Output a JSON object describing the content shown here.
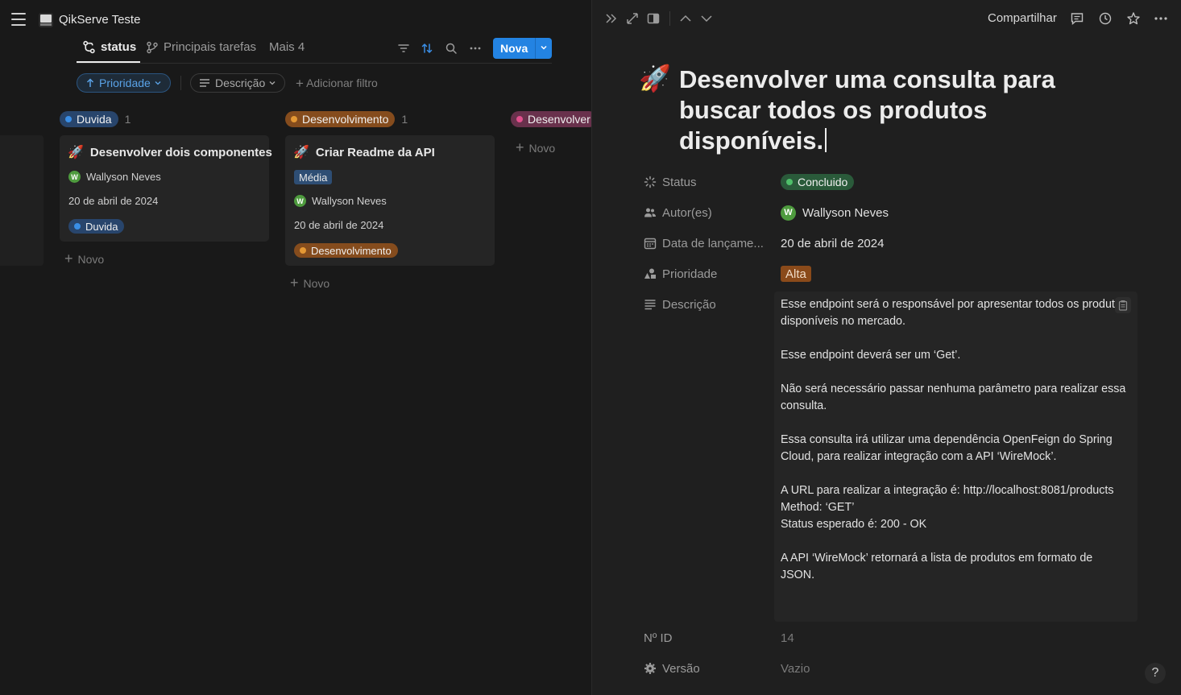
{
  "workspace": {
    "title": "QikServe Teste"
  },
  "views": {
    "tabs": [
      {
        "label": "status"
      },
      {
        "label": "Principais tarefas"
      },
      {
        "label": "Mais 4"
      }
    ],
    "new_label": "Nova"
  },
  "filters": {
    "sort_label": "Prioridade",
    "desc_label": "Descrição",
    "add_filter_label": "Adicionar filtro"
  },
  "board": {
    "new_label": "Novo",
    "columns": [
      {
        "name": "Duvida",
        "count": "1",
        "color": "#3a8ee6",
        "cards": [
          {
            "title": "Desenvolver dois componentes",
            "author_initial": "W",
            "author": "Wallyson Neves",
            "date": "20 de abril de 2024",
            "status": "Duvida"
          }
        ]
      },
      {
        "name": "Desenvolvimento",
        "count": "1",
        "color": "#e49834",
        "cards": [
          {
            "title": "Criar Readme da API",
            "priority": "Média",
            "author_initial": "W",
            "author": "Wallyson Neves",
            "date": "20 de abril de 2024",
            "status": "Desenvolvimento"
          }
        ]
      },
      {
        "name": "Desenvolver",
        "color": "#e04f8c",
        "cards": []
      }
    ]
  },
  "detail": {
    "share_label": "Compartilhar",
    "emoji": "🚀",
    "title": "Desenvolver uma consulta para buscar todos os produtos disponíveis.",
    "properties": {
      "status": {
        "label": "Status",
        "value": "Concluido",
        "color": "#4fbf6a"
      },
      "authors": {
        "label": "Autor(es)",
        "initial": "W",
        "value": "Wallyson Neves"
      },
      "release": {
        "label": "Data de lançame...",
        "value": "20 de abril de 2024"
      },
      "priority": {
        "label": "Prioridade",
        "value": "Alta",
        "color": "#8a4a1a"
      },
      "description": {
        "label": "Descrição"
      },
      "id": {
        "label": "Nº ID",
        "value": "14"
      },
      "version": {
        "label": "Versão",
        "value": "Vazio"
      }
    },
    "description": {
      "p1": "Esse endpoint será o responsável por apresentar todos os produtos disponíveis no mercado.",
      "p2": "Esse endpoint deverá ser um ‘Get’.",
      "p3": "Não será necessário passar nenhuma parâmetro para realizar essa consulta.",
      "p4": "Essa consulta irá utilizar uma dependência OpenFeign do Spring Cloud, para realizar integração com a API ‘WireMock’.",
      "p5_l1": "A URL para realizar a integração é: http://localhost:8081/products",
      "p5_l2": "Method: ‘GET’",
      "p5_l3": "Status esperado é: 200 - OK",
      "p6": "A API ‘WireMock’ retornará a lista de produtos em formato de JSON."
    }
  },
  "help_label": "?"
}
